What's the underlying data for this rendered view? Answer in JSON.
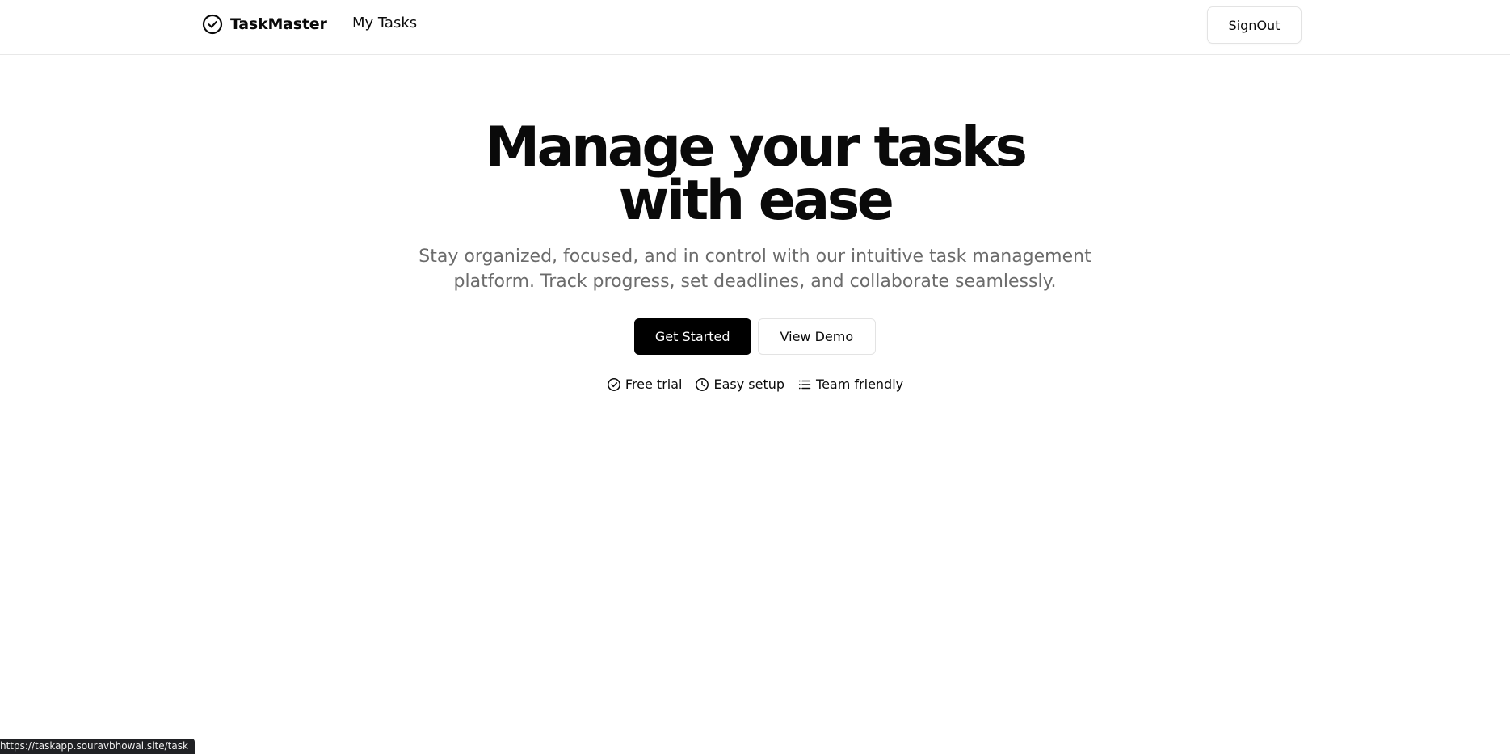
{
  "header": {
    "brand_name": "TaskMaster",
    "brand_icon": "check-circle-icon",
    "nav_my_tasks": "My Tasks",
    "signout_label": "SignOut"
  },
  "hero": {
    "title": "Manage your tasks with ease",
    "subtitle": "Stay organized, focused, and in control with our intuitive task management platform. Track progress, set deadlines, and collaborate seamlessly.",
    "primary_cta": "Get Started",
    "secondary_cta": "View Demo",
    "features": [
      {
        "icon": "check-circle-icon",
        "label": "Free trial"
      },
      {
        "icon": "clock-icon",
        "label": "Easy setup"
      },
      {
        "icon": "list-icon",
        "label": "Team friendly"
      }
    ]
  },
  "status_bar": {
    "url": "https://taskapp.souravbhowal.site/task"
  },
  "colors": {
    "primary_button_bg": "#000000",
    "primary_button_text": "#ffffff",
    "subtitle_text": "#6b6b6b",
    "border": "#e3e3e3"
  }
}
